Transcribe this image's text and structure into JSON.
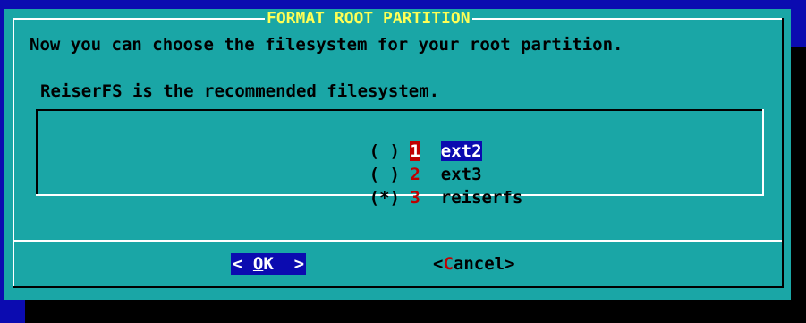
{
  "dialog": {
    "title": "FORMAT ROOT PARTITION",
    "prompt": "Now you can choose the filesystem for your root partition.",
    "recommendation": "ReiserFS is the recommended filesystem."
  },
  "options": [
    {
      "marker": "( )",
      "tag": "1",
      "label": "ext2",
      "highlighted": true
    },
    {
      "marker": "( )",
      "tag": "2",
      "label": "ext3",
      "highlighted": false
    },
    {
      "marker": "(*)",
      "tag": "3",
      "label": "reiserfs",
      "highlighted": false
    }
  ],
  "buttons": {
    "ok": {
      "left": "< ",
      "hot": "O",
      "rest": "K",
      "right": "  >"
    },
    "cancel": {
      "left": "<",
      "hot": "C",
      "rest": "ancel",
      "right": ">"
    }
  },
  "colors": {
    "desktop": "#0b0bb0",
    "dialog": "#1aa6a6",
    "title": "#ffff55",
    "hotkey": "#c00000",
    "selection": "#0b0bb0"
  }
}
